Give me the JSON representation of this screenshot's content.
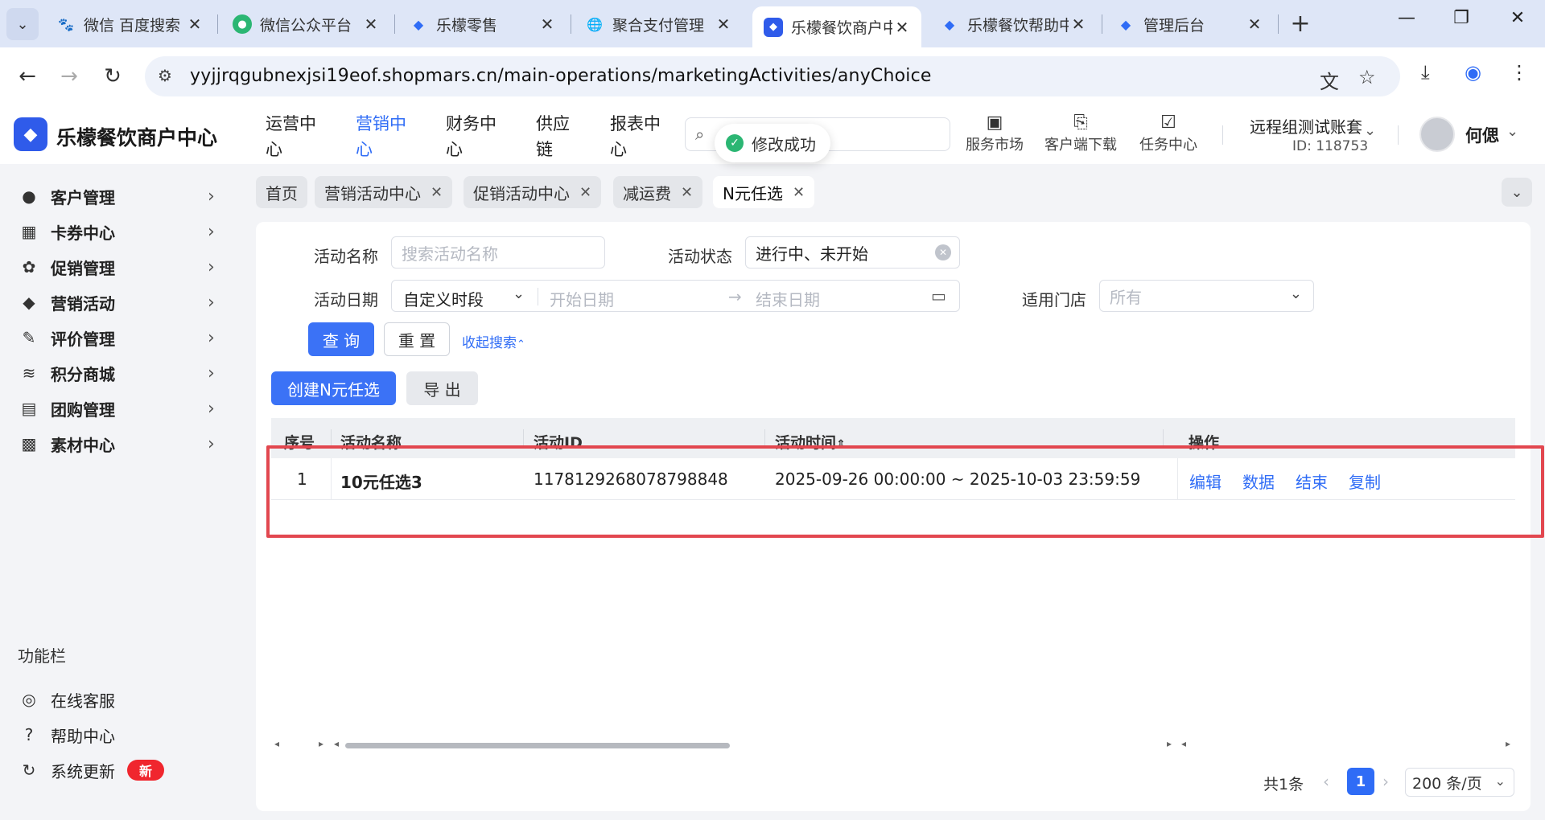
{
  "browser": {
    "tabs": [
      {
        "title": "微信 百度搜索",
        "icon": "baidu-icon"
      },
      {
        "title": "微信公众平台",
        "icon": "wechat-icon"
      },
      {
        "title": "乐檬零售",
        "icon": "lemeng-icon"
      },
      {
        "title": "聚合支付管理",
        "icon": "globe-icon"
      },
      {
        "title": "乐檬餐饮商户中心",
        "icon": "lemeng-icon"
      },
      {
        "title": "乐檬餐饮帮助中心",
        "icon": "lemeng-icon"
      },
      {
        "title": "管理后台",
        "icon": "lemeng-icon"
      }
    ],
    "url": "yyjjrqgubnexjsi19eof.shopmars.cn/main-operations/marketingActivities/anyChoice"
  },
  "header": {
    "logo_text": "乐檬餐饮商户中心",
    "nav": [
      {
        "label": "运营中心"
      },
      {
        "label": "营销中心"
      },
      {
        "label": "财务中心"
      },
      {
        "label": "供应链"
      },
      {
        "label": "报表中心"
      }
    ],
    "toast": "修改成功",
    "tools": [
      {
        "label": "服务市场"
      },
      {
        "label": "客户端下载"
      },
      {
        "label": "任务中心"
      }
    ],
    "account_name": "远程组测试账套",
    "account_id": "ID: 118753",
    "user_name": "何偲"
  },
  "sidebar": {
    "items": [
      {
        "label": "客户管理"
      },
      {
        "label": "卡券中心"
      },
      {
        "label": "促销管理"
      },
      {
        "label": "营销活动"
      },
      {
        "label": "评价管理"
      },
      {
        "label": "积分商城"
      },
      {
        "label": "团购管理"
      },
      {
        "label": "素材中心"
      }
    ],
    "section_title": "功能栏",
    "bottom_items": [
      {
        "label": "在线客服"
      },
      {
        "label": "帮助中心"
      },
      {
        "label": "系统更新"
      }
    ],
    "new_badge": "新"
  },
  "page_tabs": [
    {
      "label": "首页"
    },
    {
      "label": "营销活动中心"
    },
    {
      "label": "促销活动中心"
    },
    {
      "label": "减运费"
    },
    {
      "label": "N元任选"
    }
  ],
  "filters": {
    "name_label": "活动名称",
    "name_placeholder": "搜索活动名称",
    "status_label": "活动状态",
    "status_value": "进行中、未开始",
    "date_label": "活动日期",
    "date_mode": "自定义时段",
    "start_placeholder": "开始日期",
    "date_arrow": "→",
    "end_placeholder": "结束日期",
    "store_label": "适用门店",
    "store_placeholder": "所有",
    "query_button": "查 询",
    "reset_button": "重 置",
    "collapse_link": "收起搜索"
  },
  "actions": {
    "create_button": "创建N元任选",
    "export_button": "导 出"
  },
  "table": {
    "headers": [
      "序号",
      "活动名称",
      "活动ID",
      "活动时间",
      "操作"
    ],
    "rows": [
      {
        "index": "1",
        "name": "10元任选3",
        "id": "1178129268078798848",
        "time": "2025-09-26 00:00:00 ~ 2025-10-03 23:59:59",
        "ops": [
          "编辑",
          "数据",
          "结束",
          "复制"
        ]
      }
    ]
  },
  "pager": {
    "total": "共1条",
    "current_page": "1",
    "page_size": "200 条/页"
  },
  "colors": {
    "primary": "#3b72f6",
    "highlight_border": "#e2474f",
    "success": "#2bb673",
    "badge": "#f0262e"
  }
}
